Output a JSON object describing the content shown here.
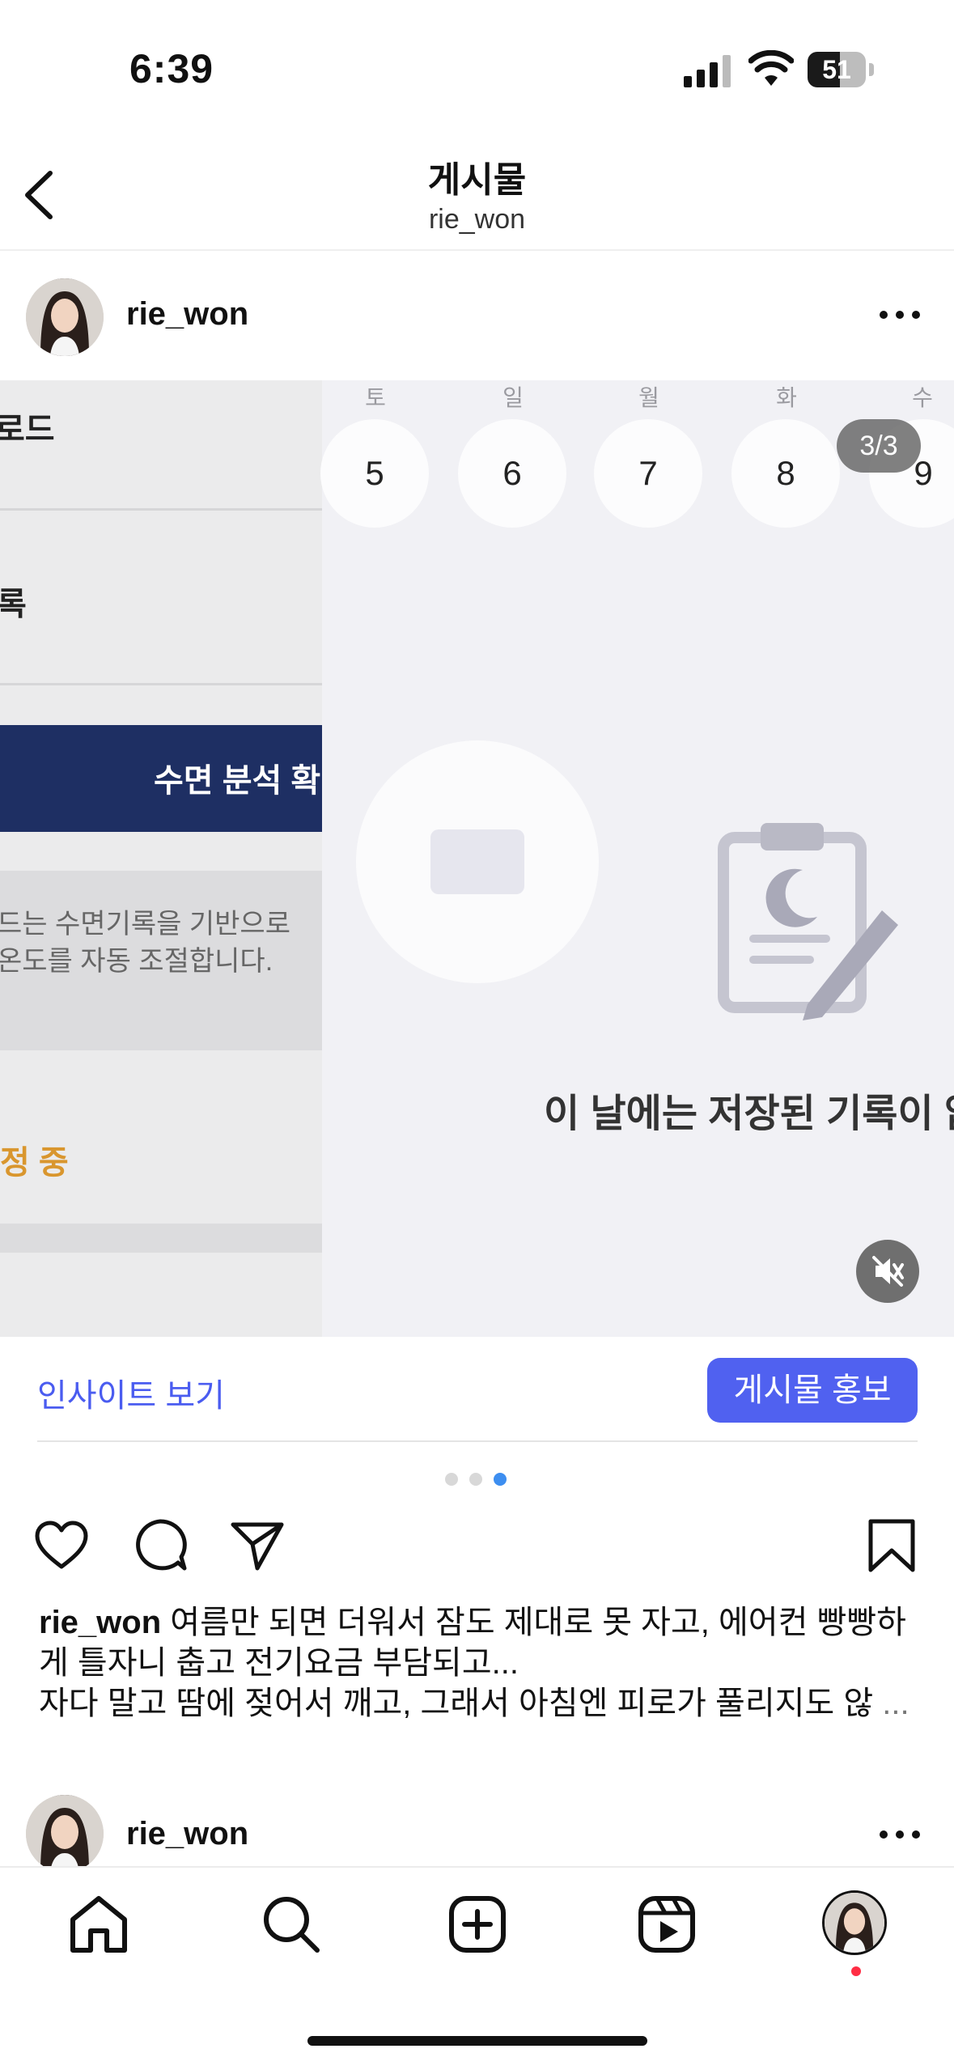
{
  "status_bar": {
    "time": "6:39",
    "battery": "51"
  },
  "header": {
    "title": "게시물",
    "subtitle": "rie_won"
  },
  "post": {
    "username": "rie_won",
    "page_indicator": "3/3",
    "left_panel": {
      "line1": "로드",
      "line2": "록",
      "button": "수면 분석 확",
      "desc_line1": "드는 수면기록을 기반으로",
      "desc_line2": "온도를 자동 조절합니다.",
      "status": "정 중"
    },
    "days": [
      {
        "label": "토",
        "num": "5"
      },
      {
        "label": "일",
        "num": "6"
      },
      {
        "label": "월",
        "num": "7"
      },
      {
        "label": "화",
        "num": "8"
      },
      {
        "label": "수",
        "num": "9"
      }
    ],
    "empty_message": "이 날에는 저장된 기록이 없",
    "insights_label": "인사이트 보기",
    "promote_label": "게시물 홍보",
    "caption_user": "rie_won",
    "caption_line1": "여름만 되면 더워서 잠도 제대로 못 자고, 에어컨 빵빵하게 틀자니 춥고 전기요금 부담되고...",
    "caption_line2": "자다 말고 땀에 젖어서 깨고, 그래서 아침엔 피로가 풀리지도 않",
    "caption_more": "...",
    "carousel": {
      "total": 3,
      "active": 3
    }
  },
  "next_post": {
    "username": "rie_won"
  },
  "icons": {
    "back": "chevron-left-icon",
    "more": "more-horizontal-icon",
    "mute": "speaker-muted-icon",
    "like": "heart-icon",
    "comment": "comment-icon",
    "share": "send-icon",
    "save": "bookmark-icon",
    "home": "home-icon",
    "search": "search-icon",
    "create": "plus-square-icon",
    "reels": "reels-icon"
  },
  "colors": {
    "accent": "#5061f0",
    "link": "#4a5cf0",
    "carousel_active": "#3d8ef0",
    "notification": "#ff2d44"
  }
}
